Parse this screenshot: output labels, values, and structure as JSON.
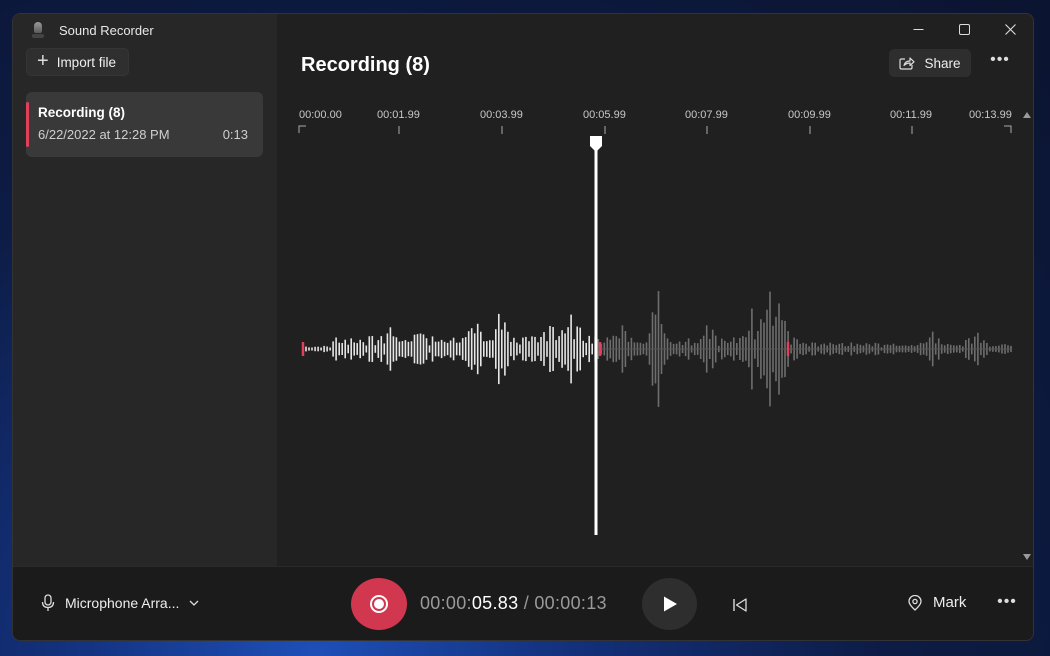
{
  "app": {
    "title": "Sound Recorder",
    "icon": "microphone-app-icon"
  },
  "sidebar": {
    "import_label": "Import file",
    "recordings": [
      {
        "name": "Recording (8)",
        "date": "6/22/2022 at 12:28 PM",
        "duration": "0:13"
      }
    ]
  },
  "header": {
    "title": "Recording (8)",
    "share_label": "Share"
  },
  "timeline": {
    "ticks": [
      "00:00.00",
      "00:01.99",
      "00:03.99",
      "00:05.99",
      "00:07.99",
      "00:09.99",
      "00:11.99",
      "00:13.99"
    ],
    "playhead_time": "00:00:05.83",
    "progress_fraction": 0.415,
    "played_color": "#e6e6e6",
    "unplayed_color": "#6e6e6e",
    "marker_color": "#e0405a"
  },
  "player": {
    "microphone_label": "Microphone Arra...",
    "time_prefix": "00:00:",
    "time_current": "05.83",
    "time_separator": "/",
    "time_total": "00:00:13",
    "mark_label": "Mark"
  },
  "colors": {
    "accent": "#d1374f",
    "window_bg": "#202020",
    "sidebar_bg": "#272727"
  }
}
